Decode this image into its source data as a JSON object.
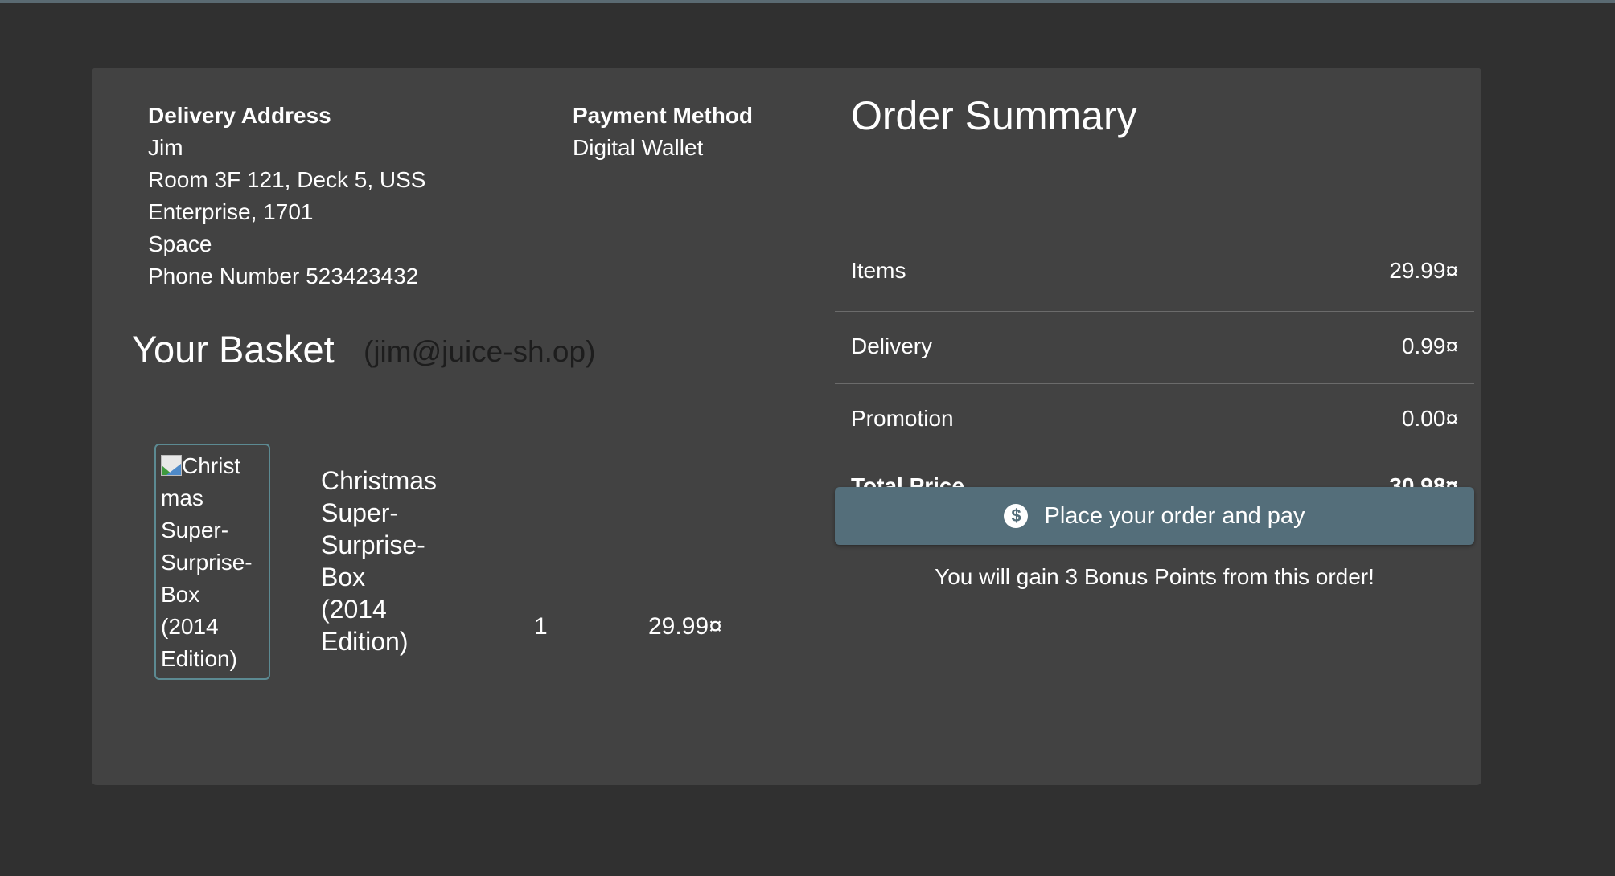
{
  "delivery": {
    "heading": "Delivery Address",
    "lines": [
      "Jim",
      "Room 3F 121, Deck 5, USS",
      "Enterprise, 1701",
      "Space",
      "Phone Number 523423432"
    ]
  },
  "payment": {
    "heading": "Payment Method",
    "method": "Digital Wallet"
  },
  "basket": {
    "title": "Your Basket",
    "email": "(jim@juice-sh.op)",
    "items": [
      {
        "image_alt_lines": [
          "Christ",
          "mas",
          "Super-",
          "Surprise-",
          "Box",
          "(2014",
          "Edition)"
        ],
        "name_lines": [
          "Christmas",
          "Super-",
          "Surprise-",
          "Box",
          "(2014",
          "Edition)"
        ],
        "quantity": "1",
        "price": "29.99¤"
      }
    ]
  },
  "summary": {
    "title": "Order Summary",
    "rows": [
      {
        "label": "Items",
        "value": "29.99¤"
      },
      {
        "label": "Delivery",
        "value": "0.99¤"
      },
      {
        "label": "Promotion",
        "value": "0.00¤"
      },
      {
        "label": "Total Price",
        "value": "30.98¤"
      }
    ],
    "pay_button": {
      "icon": "dollar-circle-icon",
      "label": "Place your order and pay"
    },
    "bonus_text": "You will gain 3 Bonus Points from this order!"
  },
  "colors": {
    "background": "#303030",
    "card": "#424242",
    "button": "#546e7a",
    "image_border": "#5c8a92"
  }
}
